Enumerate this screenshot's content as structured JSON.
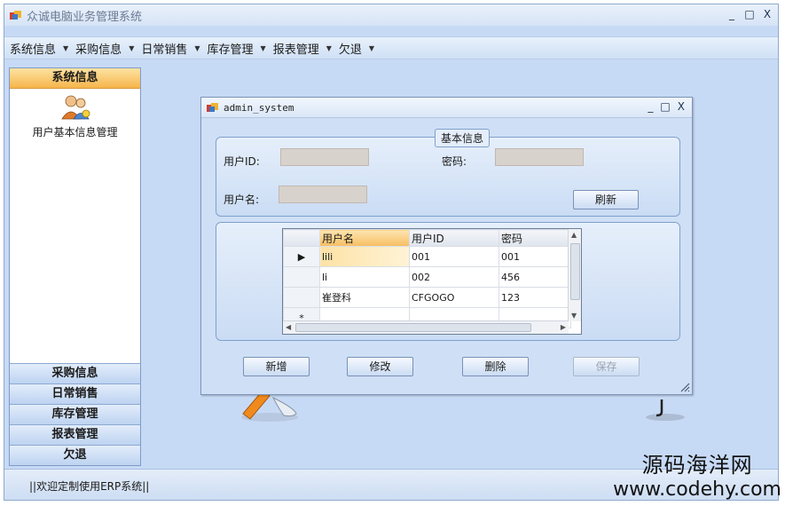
{
  "app": {
    "title": "众诚电脑业务管理系统",
    "window_controls": [
      "_",
      "□",
      "X"
    ]
  },
  "menubar": {
    "items": [
      {
        "label": "系统信息"
      },
      {
        "label": "采购信息"
      },
      {
        "label": "日常销售"
      },
      {
        "label": "库存管理"
      },
      {
        "label": "报表管理"
      },
      {
        "label": "欠退"
      }
    ]
  },
  "sidebar": {
    "active_section": "系统信息",
    "tool_label": "用户基本信息管理",
    "sections": [
      "采购信息",
      "日常销售",
      "库存管理",
      "报表管理",
      "欠退"
    ]
  },
  "status": {
    "text": "||欢迎定制使用ERP系统||"
  },
  "dialog": {
    "title": "admin_system",
    "controls": [
      "_",
      "□",
      "X"
    ],
    "group_title": "基本信息",
    "labels": {
      "user_id": "用户ID:",
      "password": "密码:",
      "username": "用户名:"
    },
    "refresh_label": "刷新",
    "grid": {
      "columns": [
        "用户名",
        "用户ID",
        "密码"
      ],
      "rows": [
        {
          "name": "lili",
          "id": "001",
          "pwd": "001"
        },
        {
          "name": "li",
          "id": "002",
          "pwd": "456"
        },
        {
          "name": "崔登科",
          "id": "CFGOGO",
          "pwd": "123"
        }
      ],
      "new_row_marker": "*",
      "current_row_marker": "▶"
    },
    "buttons": {
      "add": "新增",
      "edit": "修改",
      "delete": "删除",
      "save": "保存"
    }
  },
  "watermark": {
    "line1": "源码海洋网",
    "line2": "www.codehy.com"
  }
}
